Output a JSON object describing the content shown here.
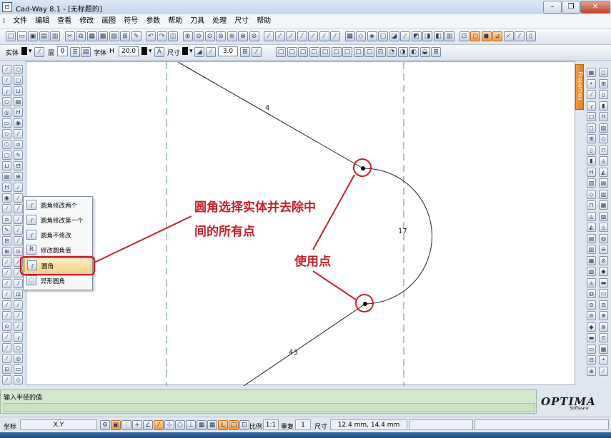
{
  "window": {
    "title": "Cad-Way 8.1 - [无标题的]",
    "app_icon": "cad-app-icon",
    "controls": [
      "minimize-icon",
      "restore-icon",
      "close-icon"
    ]
  },
  "menu": [
    "文件",
    "编辑",
    "查看",
    "修改",
    "画图",
    "符号",
    "参数",
    "帮助",
    "刀具",
    "处理",
    "尺寸",
    "帮助"
  ],
  "toolbar2": {
    "entity_label": "实体",
    "layer_label": "层",
    "layer_value": "0",
    "font_label": "字体",
    "height_label": "H",
    "height_value": "20.0",
    "dim_label": "尺寸",
    "value": "3.0"
  },
  "flyout": {
    "items": [
      {
        "label": "圆角修改两个",
        "icon": "fillet-modify-both-icon"
      },
      {
        "label": "圆角修改第一个",
        "icon": "fillet-modify-first-icon"
      },
      {
        "label": "圆角不修改",
        "icon": "fillet-no-modify-icon"
      },
      {
        "label": "修改圆角值",
        "icon": "fillet-value-icon"
      },
      {
        "label": "圆角",
        "icon": "fillet-icon"
      },
      {
        "label": "异形圆角",
        "icon": "special-fillet-icon"
      }
    ],
    "highlighted_index": 4
  },
  "drawing": {
    "dim_top": "4",
    "dim_right": "17",
    "dim_bottom": "43"
  },
  "annotations": {
    "main_line1": "圆角选择实体并去除中",
    "main_line2": "间的所有点",
    "use_points": "使用点",
    "color": "#c8202a"
  },
  "properties_tab": "Properties",
  "command": {
    "prompt": "输入半径的值"
  },
  "logo": {
    "text": "OPTIMA",
    "sub": "Software"
  },
  "status": {
    "coord_label": "坐标",
    "coord_mode": "X,Y",
    "scale_label": "比例",
    "scale_value": "1:1",
    "repeat_label": "重复",
    "repeat_value": "1",
    "dim_label": "尺寸",
    "coords": "12.4 mm,   14.4 mm"
  },
  "colors": {
    "canvas": "#ffffff",
    "grid_dash": "#5a9a5a",
    "accent_orange": "#f39a3c",
    "command_bg": "#d4e8cf"
  }
}
